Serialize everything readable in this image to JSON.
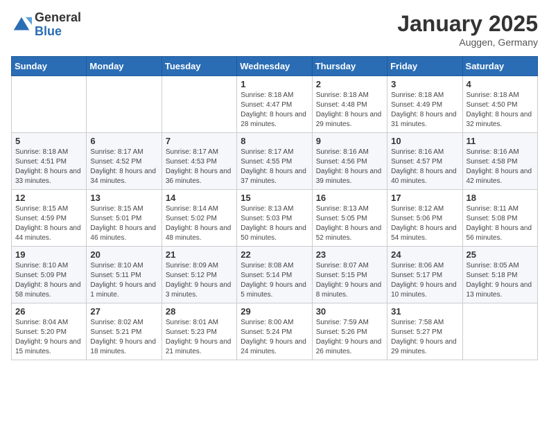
{
  "header": {
    "logo_general": "General",
    "logo_blue": "Blue",
    "month_title": "January 2025",
    "location": "Auggen, Germany"
  },
  "days_of_week": [
    "Sunday",
    "Monday",
    "Tuesday",
    "Wednesday",
    "Thursday",
    "Friday",
    "Saturday"
  ],
  "weeks": [
    [
      {
        "day": "",
        "info": ""
      },
      {
        "day": "",
        "info": ""
      },
      {
        "day": "",
        "info": ""
      },
      {
        "day": "1",
        "info": "Sunrise: 8:18 AM\nSunset: 4:47 PM\nDaylight: 8 hours and 28 minutes."
      },
      {
        "day": "2",
        "info": "Sunrise: 8:18 AM\nSunset: 4:48 PM\nDaylight: 8 hours and 29 minutes."
      },
      {
        "day": "3",
        "info": "Sunrise: 8:18 AM\nSunset: 4:49 PM\nDaylight: 8 hours and 31 minutes."
      },
      {
        "day": "4",
        "info": "Sunrise: 8:18 AM\nSunset: 4:50 PM\nDaylight: 8 hours and 32 minutes."
      }
    ],
    [
      {
        "day": "5",
        "info": "Sunrise: 8:18 AM\nSunset: 4:51 PM\nDaylight: 8 hours and 33 minutes."
      },
      {
        "day": "6",
        "info": "Sunrise: 8:17 AM\nSunset: 4:52 PM\nDaylight: 8 hours and 34 minutes."
      },
      {
        "day": "7",
        "info": "Sunrise: 8:17 AM\nSunset: 4:53 PM\nDaylight: 8 hours and 36 minutes."
      },
      {
        "day": "8",
        "info": "Sunrise: 8:17 AM\nSunset: 4:55 PM\nDaylight: 8 hours and 37 minutes."
      },
      {
        "day": "9",
        "info": "Sunrise: 8:16 AM\nSunset: 4:56 PM\nDaylight: 8 hours and 39 minutes."
      },
      {
        "day": "10",
        "info": "Sunrise: 8:16 AM\nSunset: 4:57 PM\nDaylight: 8 hours and 40 minutes."
      },
      {
        "day": "11",
        "info": "Sunrise: 8:16 AM\nSunset: 4:58 PM\nDaylight: 8 hours and 42 minutes."
      }
    ],
    [
      {
        "day": "12",
        "info": "Sunrise: 8:15 AM\nSunset: 4:59 PM\nDaylight: 8 hours and 44 minutes."
      },
      {
        "day": "13",
        "info": "Sunrise: 8:15 AM\nSunset: 5:01 PM\nDaylight: 8 hours and 46 minutes."
      },
      {
        "day": "14",
        "info": "Sunrise: 8:14 AM\nSunset: 5:02 PM\nDaylight: 8 hours and 48 minutes."
      },
      {
        "day": "15",
        "info": "Sunrise: 8:13 AM\nSunset: 5:03 PM\nDaylight: 8 hours and 50 minutes."
      },
      {
        "day": "16",
        "info": "Sunrise: 8:13 AM\nSunset: 5:05 PM\nDaylight: 8 hours and 52 minutes."
      },
      {
        "day": "17",
        "info": "Sunrise: 8:12 AM\nSunset: 5:06 PM\nDaylight: 8 hours and 54 minutes."
      },
      {
        "day": "18",
        "info": "Sunrise: 8:11 AM\nSunset: 5:08 PM\nDaylight: 8 hours and 56 minutes."
      }
    ],
    [
      {
        "day": "19",
        "info": "Sunrise: 8:10 AM\nSunset: 5:09 PM\nDaylight: 8 hours and 58 minutes."
      },
      {
        "day": "20",
        "info": "Sunrise: 8:10 AM\nSunset: 5:11 PM\nDaylight: 9 hours and 1 minute."
      },
      {
        "day": "21",
        "info": "Sunrise: 8:09 AM\nSunset: 5:12 PM\nDaylight: 9 hours and 3 minutes."
      },
      {
        "day": "22",
        "info": "Sunrise: 8:08 AM\nSunset: 5:14 PM\nDaylight: 9 hours and 5 minutes."
      },
      {
        "day": "23",
        "info": "Sunrise: 8:07 AM\nSunset: 5:15 PM\nDaylight: 9 hours and 8 minutes."
      },
      {
        "day": "24",
        "info": "Sunrise: 8:06 AM\nSunset: 5:17 PM\nDaylight: 9 hours and 10 minutes."
      },
      {
        "day": "25",
        "info": "Sunrise: 8:05 AM\nSunset: 5:18 PM\nDaylight: 9 hours and 13 minutes."
      }
    ],
    [
      {
        "day": "26",
        "info": "Sunrise: 8:04 AM\nSunset: 5:20 PM\nDaylight: 9 hours and 15 minutes."
      },
      {
        "day": "27",
        "info": "Sunrise: 8:02 AM\nSunset: 5:21 PM\nDaylight: 9 hours and 18 minutes."
      },
      {
        "day": "28",
        "info": "Sunrise: 8:01 AM\nSunset: 5:23 PM\nDaylight: 9 hours and 21 minutes."
      },
      {
        "day": "29",
        "info": "Sunrise: 8:00 AM\nSunset: 5:24 PM\nDaylight: 9 hours and 24 minutes."
      },
      {
        "day": "30",
        "info": "Sunrise: 7:59 AM\nSunset: 5:26 PM\nDaylight: 9 hours and 26 minutes."
      },
      {
        "day": "31",
        "info": "Sunrise: 7:58 AM\nSunset: 5:27 PM\nDaylight: 9 hours and 29 minutes."
      },
      {
        "day": "",
        "info": ""
      }
    ]
  ]
}
